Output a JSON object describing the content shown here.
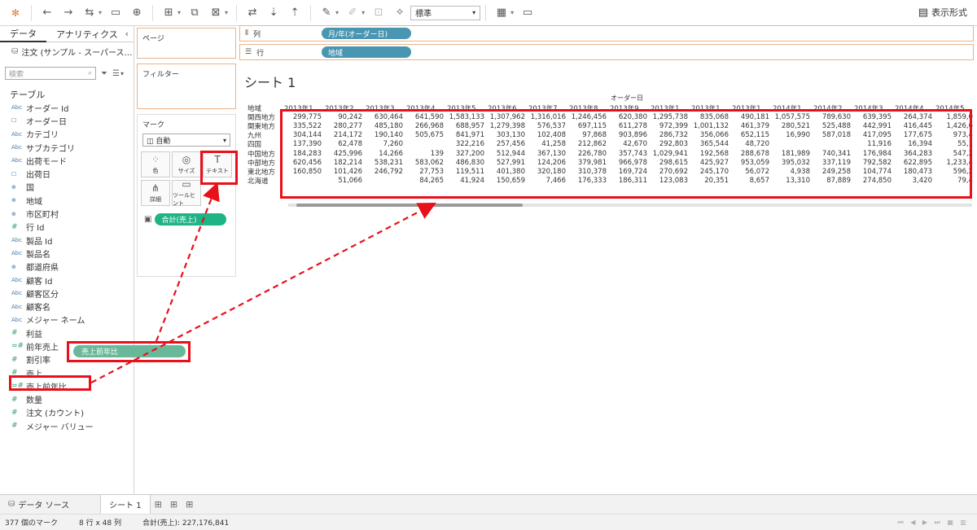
{
  "toolbar": {
    "format_select": "標準",
    "show_me_label": "表示形式",
    "icons": [
      "tableau-logo-icon",
      "undo-icon",
      "redo-icon",
      "replay-icon",
      "save-icon",
      "new-datasource-icon",
      "new-sheet-icon",
      "duplicate-icon",
      "clear-icon",
      "swap-icon",
      "sort-asc-icon",
      "sort-desc-icon",
      "highlight-icon",
      "group-icon",
      "label-icon",
      "pin-icon",
      "fit-icon",
      "presentation-icon"
    ]
  },
  "datapane": {
    "tabs": [
      "データ",
      "アナリティクス"
    ],
    "datasource": "注文 (サンプル - スーパース…",
    "search_placeholder": "検索",
    "section_title": "テーブル",
    "fields": [
      {
        "type": "Abc",
        "name": "オーダー Id"
      },
      {
        "type": "cal",
        "name": "オーダー日"
      },
      {
        "type": "Abc",
        "name": "カテゴリ"
      },
      {
        "type": "Abc",
        "name": "サブカテゴリ"
      },
      {
        "type": "Abc",
        "name": "出荷モード"
      },
      {
        "type": "cal",
        "name": "出荷日"
      },
      {
        "type": "geo",
        "name": "国"
      },
      {
        "type": "geo",
        "name": "地域"
      },
      {
        "type": "geo",
        "name": "市区町村"
      },
      {
        "type": "#",
        "name": "行 Id"
      },
      {
        "type": "Abc",
        "name": "製品 Id"
      },
      {
        "type": "Abc",
        "name": "製品名"
      },
      {
        "type": "geo",
        "name": "都道府県"
      },
      {
        "type": "Abc",
        "name": "顧客 Id"
      },
      {
        "type": "Abc",
        "name": "顧客区分"
      },
      {
        "type": "Abc",
        "name": "顧客名"
      },
      {
        "type": "Abc",
        "name": "メジャー ネーム"
      },
      {
        "type": "#",
        "name": "利益"
      },
      {
        "type": "=#",
        "name": "前年売上"
      },
      {
        "type": "#",
        "name": "割引率"
      },
      {
        "type": "#",
        "name": "売上"
      },
      {
        "type": "=#",
        "name": "売上前年比"
      },
      {
        "type": "#",
        "name": "数量"
      },
      {
        "type": "#",
        "name": "注文 (カウント)"
      },
      {
        "type": "#",
        "name": "メジャー バリュー"
      }
    ]
  },
  "cards": {
    "pages": "ページ",
    "filters": "フィルター",
    "marks": "マーク",
    "mark_type": "自動",
    "mark_buttons": [
      "色",
      "サイズ",
      "テキスト",
      "詳細",
      "ツールヒント"
    ],
    "mark_pill": "合計(売上)"
  },
  "shelves": {
    "columns_label": "列",
    "columns_pill": "月/年(オーダー日)",
    "rows_label": "行",
    "rows_pill": "地域"
  },
  "drag_pill": "売上前年比",
  "canvas": {
    "title": "シート 1",
    "top_header": "オーダー日",
    "row_header_label": "地域",
    "columns": [
      "2013年1..",
      "2013年2..",
      "2013年3..",
      "2013年4..",
      "2013年5..",
      "2013年6..",
      "2013年7..",
      "2013年8..",
      "2013年9..",
      "2013年1..",
      "2013年1..",
      "2013年1..",
      "2014年1..",
      "2014年2..",
      "2014年3..",
      "2014年4..",
      "2014年5"
    ],
    "rows": [
      {
        "region": "関西地方",
        "values": [
          "299,775",
          "90,242",
          "630,464",
          "641,590",
          "1,583,133",
          "1,307,962",
          "1,316,016",
          "1,246,456",
          "620,380",
          "1,295,738",
          "835,068",
          "490,181",
          "1,057,575",
          "789,630",
          "639,395",
          "264,374",
          "1,859,0"
        ]
      },
      {
        "region": "関東地方",
        "values": [
          "335,522",
          "280,277",
          "485,180",
          "266,968",
          "688,957",
          "1,279,398",
          "576,537",
          "697,115",
          "611,278",
          "972,399",
          "1,001,132",
          "461,379",
          "280,521",
          "525,488",
          "442,991",
          "416,445",
          "1,426,6"
        ]
      },
      {
        "region": "九州",
        "values": [
          "304,144",
          "214,172",
          "190,140",
          "505,675",
          "841,971",
          "303,130",
          "102,408",
          "97,868",
          "903,896",
          "286,732",
          "356,066",
          "652,115",
          "16,990",
          "587,018",
          "417,095",
          "177,675",
          "973,4"
        ]
      },
      {
        "region": "四国",
        "values": [
          "137,390",
          "62,478",
          "7,260",
          "",
          "322,216",
          "257,456",
          "41,258",
          "212,862",
          "42,670",
          "292,803",
          "365,544",
          "48,720",
          "",
          "",
          "11,916",
          "16,394",
          "55,1"
        ]
      },
      {
        "region": "中国地方",
        "values": [
          "184,283",
          "425,996",
          "14,266",
          "139",
          "327,200",
          "512,944",
          "367,130",
          "226,780",
          "357,743",
          "1,029,941",
          "192,568",
          "288,678",
          "181,989",
          "740,341",
          "176,984",
          "364,283",
          "547,2"
        ]
      },
      {
        "region": "中部地方",
        "values": [
          "620,456",
          "182,214",
          "538,231",
          "583,062",
          "486,830",
          "527,991",
          "124,206",
          "379,981",
          "966,978",
          "298,615",
          "425,927",
          "953,059",
          "395,032",
          "337,119",
          "792,582",
          "622,895",
          "1,233,4"
        ]
      },
      {
        "region": "東北地方",
        "values": [
          "160,850",
          "101,426",
          "246,792",
          "27,753",
          "119,511",
          "401,380",
          "320,180",
          "310,378",
          "169,724",
          "270,692",
          "245,170",
          "56,072",
          "4,938",
          "249,258",
          "104,774",
          "180,473",
          "596,2"
        ]
      },
      {
        "region": "北海道",
        "values": [
          "",
          "51,066",
          "",
          "84,265",
          "41,924",
          "150,659",
          "7,466",
          "176,333",
          "186,311",
          "123,083",
          "20,351",
          "8,657",
          "13,310",
          "87,889",
          "274,850",
          "3,420",
          "79,4"
        ]
      }
    ]
  },
  "sheettabs": {
    "datasource_tab": "データ ソース",
    "sheet_tab": "シート 1"
  },
  "status": {
    "marks": "377 個のマーク",
    "dims": "8 行 x 48 列",
    "sum": "合計(売上): 227,176,841"
  },
  "colors": {
    "annotation_red": "#e8101a",
    "dimension_pill": "#4996b2",
    "measure_pill": "#1fb486",
    "shelf_border": "#e8b48a"
  }
}
